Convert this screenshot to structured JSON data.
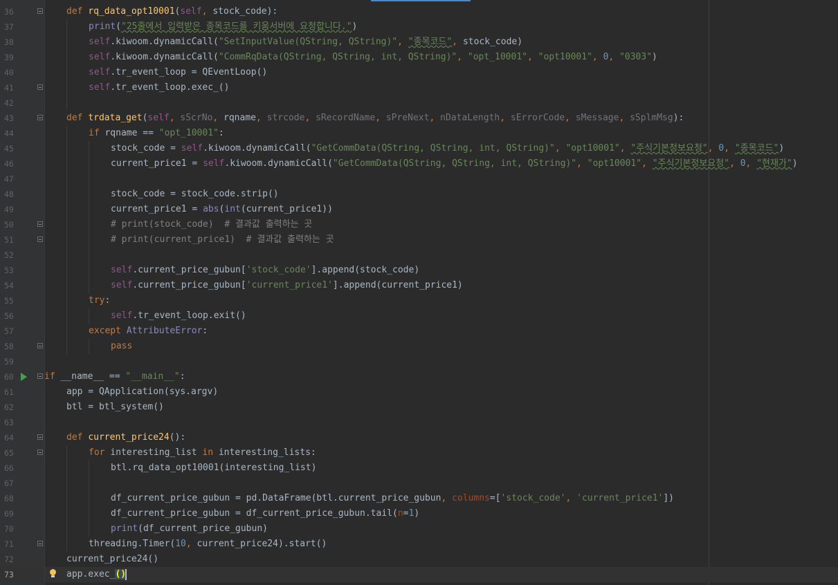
{
  "editor": {
    "lines": [
      {
        "number": "36",
        "tokens": [
          [
            "kw",
            "def "
          ],
          [
            "fn",
            "rq_data_opt10001"
          ],
          [
            "",
            "("
          ],
          [
            "sf",
            "self"
          ],
          [
            "kw",
            ", "
          ],
          [
            "",
            "stock_code):"
          ]
        ]
      },
      {
        "number": "37",
        "tokens": [
          [
            "bi",
            "print"
          ],
          [
            "",
            "("
          ],
          [
            "st",
            "\"25줄에서 입력받은 종목코드를 키움서버에 요청합니다.\""
          ],
          [
            "",
            ")"
          ]
        ]
      },
      {
        "number": "38",
        "tokens": [
          [
            "sf",
            "self"
          ],
          [
            "",
            ".kiwoom.dynamicCall("
          ],
          [
            "st",
            "\"SetInputValue(QString, QString)\""
          ],
          [
            "kw",
            ", "
          ],
          [
            "st",
            "\"종목코드\""
          ],
          [
            "kw",
            ", "
          ],
          [
            "",
            "stock_code)"
          ]
        ]
      },
      {
        "number": "39",
        "tokens": [
          [
            "sf",
            "self"
          ],
          [
            "",
            ".kiwoom.dynamicCall("
          ],
          [
            "st",
            "\"CommRqData(QString, QString, int, QString)\""
          ],
          [
            "kw",
            ", "
          ],
          [
            "st",
            "\"opt_10001\""
          ],
          [
            "kw",
            ", "
          ],
          [
            "st",
            "\"opt10001\""
          ],
          [
            "kw",
            ", "
          ],
          [
            "nm",
            "0"
          ],
          [
            "kw",
            ", "
          ],
          [
            "st",
            "\"0303\""
          ],
          [
            "",
            ")"
          ]
        ]
      },
      {
        "number": "40",
        "tokens": [
          [
            "sf",
            "self"
          ],
          [
            "",
            ".tr_event_loop = QEventLoop()"
          ]
        ]
      },
      {
        "number": "41",
        "tokens": [
          [
            "sf",
            "self"
          ],
          [
            "",
            ".tr_event_loop.exec_()"
          ]
        ]
      },
      {
        "number": "42",
        "tokens": []
      },
      {
        "number": "43",
        "tokens": [
          [
            "kw",
            "def "
          ],
          [
            "fn",
            "trdata_get"
          ],
          [
            "",
            "("
          ],
          [
            "sf",
            "self"
          ],
          [
            "kw",
            ", "
          ],
          [
            "un",
            "sScrNo"
          ],
          [
            "kw",
            ", "
          ],
          [
            "",
            "rqname"
          ],
          [
            "kw",
            ", "
          ],
          [
            "un",
            "strcode"
          ],
          [
            "kw",
            ", "
          ],
          [
            "un",
            "sRecordName"
          ],
          [
            "kw",
            ", "
          ],
          [
            "un",
            "sPreNext"
          ],
          [
            "kw",
            ", "
          ],
          [
            "un",
            "nDataLength"
          ],
          [
            "kw",
            ", "
          ],
          [
            "un",
            "sErrorCode"
          ],
          [
            "kw",
            ", "
          ],
          [
            "un",
            "sMessage"
          ],
          [
            "kw",
            ", "
          ],
          [
            "un",
            "sSplmMsg"
          ],
          [
            "",
            "):"
          ]
        ]
      },
      {
        "number": "44",
        "tokens": [
          [
            "kw",
            "if "
          ],
          [
            "",
            "rqname == "
          ],
          [
            "st",
            "\"opt_10001\""
          ],
          [
            "",
            ":"
          ]
        ]
      },
      {
        "number": "45",
        "tokens": [
          [
            "",
            "stock_code = "
          ],
          [
            "sf",
            "self"
          ],
          [
            "",
            ".kiwoom.dynamicCall("
          ],
          [
            "st",
            "\"GetCommData(QString, QString, int, QString)\""
          ],
          [
            "kw",
            ", "
          ],
          [
            "st",
            "\"opt10001\""
          ],
          [
            "kw",
            ", "
          ],
          [
            "st",
            "\"주식기본정보요청\""
          ],
          [
            "kw",
            ", "
          ],
          [
            "nm",
            "0"
          ],
          [
            "kw",
            ", "
          ],
          [
            "st",
            "\"종목코드\""
          ],
          [
            "",
            ")"
          ]
        ]
      },
      {
        "number": "46",
        "tokens": [
          [
            "",
            "current_price1 = "
          ],
          [
            "sf",
            "self"
          ],
          [
            "",
            ".kiwoom.dynamicCall("
          ],
          [
            "st",
            "\"GetCommData(QString, QString, int, QString)\""
          ],
          [
            "kw",
            ", "
          ],
          [
            "st",
            "\"opt10001\""
          ],
          [
            "kw",
            ", "
          ],
          [
            "st",
            "\"주식기본정보요청\""
          ],
          [
            "kw",
            ", "
          ],
          [
            "nm",
            "0"
          ],
          [
            "kw",
            ", "
          ],
          [
            "st",
            "\"현재가\""
          ],
          [
            "",
            ")"
          ]
        ]
      },
      {
        "number": "47",
        "tokens": []
      },
      {
        "number": "48",
        "tokens": [
          [
            "",
            "stock_code = stock_code.strip()"
          ]
        ]
      },
      {
        "number": "49",
        "tokens": [
          [
            "",
            "current_price1 = "
          ],
          [
            "bi",
            "abs"
          ],
          [
            "",
            "("
          ],
          [
            "bi",
            "int"
          ],
          [
            "",
            "(current_price1))"
          ]
        ]
      },
      {
        "number": "50",
        "tokens": [
          [
            "cm",
            "# print(stock_code)  # 결과값 출력하는 곳"
          ]
        ]
      },
      {
        "number": "51",
        "tokens": [
          [
            "cm",
            "# print(current_price1)  # 결과값 출력하는 곳"
          ]
        ]
      },
      {
        "number": "52",
        "tokens": []
      },
      {
        "number": "53",
        "tokens": [
          [
            "sf",
            "self"
          ],
          [
            "",
            ".current_price_gubun["
          ],
          [
            "st",
            "'stock_code'"
          ],
          [
            "",
            "].append(stock_code)"
          ]
        ]
      },
      {
        "number": "54",
        "tokens": [
          [
            "sf",
            "self"
          ],
          [
            "",
            ".current_price_gubun["
          ],
          [
            "st",
            "'current_price1'"
          ],
          [
            "",
            "].append(current_price1)"
          ]
        ]
      },
      {
        "number": "55",
        "tokens": [
          [
            "kw",
            "try"
          ],
          [
            "",
            ":"
          ]
        ]
      },
      {
        "number": "56",
        "tokens": [
          [
            "sf",
            "self"
          ],
          [
            "",
            ".tr_event_loop.exit()"
          ]
        ]
      },
      {
        "number": "57",
        "tokens": [
          [
            "kw",
            "except "
          ],
          [
            "bi",
            "AttributeError"
          ],
          [
            "",
            ":"
          ]
        ]
      },
      {
        "number": "58",
        "tokens": [
          [
            "kw",
            "pass"
          ]
        ]
      },
      {
        "number": "59",
        "tokens": []
      },
      {
        "number": "60",
        "tokens": [
          [
            "kw",
            "if "
          ],
          [
            "",
            "__name__ == "
          ],
          [
            "st",
            "\"__main__\""
          ],
          [
            "",
            ":"
          ]
        ]
      },
      {
        "number": "61",
        "tokens": [
          [
            "",
            "app = QApplication(sys.argv)"
          ]
        ]
      },
      {
        "number": "62",
        "tokens": [
          [
            "",
            "btl = btl_system()"
          ]
        ]
      },
      {
        "number": "63",
        "tokens": []
      },
      {
        "number": "64",
        "tokens": [
          [
            "kw",
            "def "
          ],
          [
            "fn",
            "current_price24"
          ],
          [
            "",
            "():"
          ]
        ]
      },
      {
        "number": "65",
        "tokens": [
          [
            "kw",
            "for "
          ],
          [
            "",
            "interesting_list "
          ],
          [
            "kw",
            "in "
          ],
          [
            "",
            "interesting_lists:"
          ]
        ]
      },
      {
        "number": "66",
        "tokens": [
          [
            "",
            "btl.rq_data_opt10001(interesting_list)"
          ]
        ]
      },
      {
        "number": "67",
        "tokens": []
      },
      {
        "number": "68",
        "tokens": [
          [
            "",
            "df_current_price_gubun = pd.DataFrame(btl.current_price_gubun"
          ],
          [
            "kw",
            ", "
          ],
          [
            "pr",
            "columns"
          ],
          [
            "",
            "=["
          ],
          [
            "st",
            "'stock_code'"
          ],
          [
            "kw",
            ", "
          ],
          [
            "st",
            "'current_price1'"
          ],
          [
            "",
            "])"
          ]
        ]
      },
      {
        "number": "69",
        "tokens": [
          [
            "",
            "df_current_price_gubun = df_current_price_gubun.tail("
          ],
          [
            "pr",
            "n"
          ],
          [
            "",
            "="
          ],
          [
            "nm",
            "1"
          ],
          [
            "",
            ")"
          ]
        ]
      },
      {
        "number": "70",
        "tokens": [
          [
            "bi",
            "print"
          ],
          [
            "",
            "(df_current_price_gubun)"
          ]
        ]
      },
      {
        "number": "71",
        "tokens": [
          [
            "",
            "threading.Timer("
          ],
          [
            "nm",
            "10"
          ],
          [
            "kw",
            ", "
          ],
          [
            "",
            "current_price24).start()"
          ]
        ]
      },
      {
        "number": "72",
        "tokens": [
          [
            "",
            "current_price24()"
          ]
        ]
      },
      {
        "number": "73",
        "tokens": [
          [
            "",
            "app.exec_"
          ],
          [
            "mt",
            "()"
          ]
        ]
      }
    ]
  }
}
